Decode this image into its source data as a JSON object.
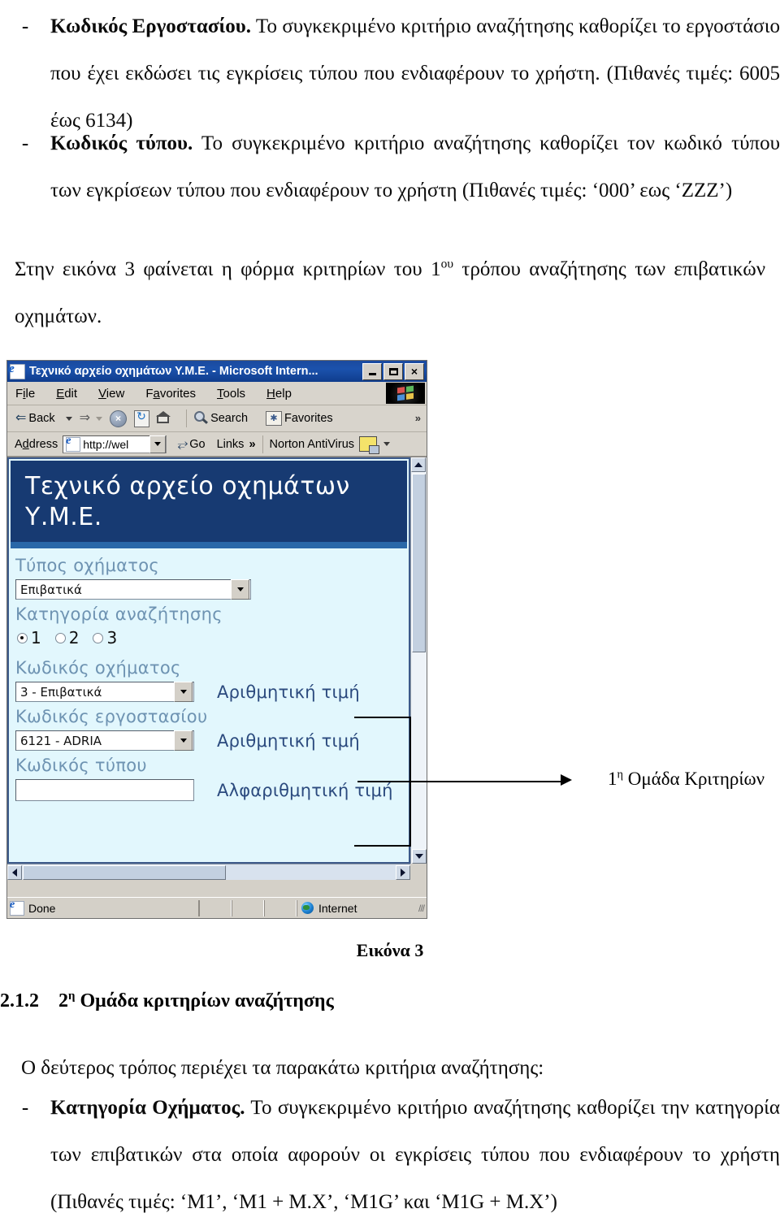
{
  "document": {
    "bullets_top": [
      {
        "dash": "-",
        "term": "Κωδικός Εργοστασίου.",
        "text": " Το συγκεκριμένο κριτήριο αναζήτησης καθορίζει το εργοστάσιο που έχει εκδώσει τις εγκρίσεις τύπου που ενδιαφέρουν το χρήστη. (Πιθανές τιμές: 6005 έως 6134)"
      },
      {
        "dash": "-",
        "term": "Κωδικός τύπου.",
        "text": " Το συγκεκριμένο κριτήριο αναζήτησης καθορίζει τον κωδικό τύπου των εγκρίσεων τύπου που ενδιαφέρουν το χρήστη (Πιθανές τιμές: ‘000’ εως ‘ZZZ’)"
      }
    ],
    "paragraph_intro_a": "Στην εικόνα 3 φαίνεται η φόρμα κριτηρίων του 1",
    "paragraph_intro_sup": "ου",
    "paragraph_intro_b": " τρόπου αναζήτησης των επιβατικών οχημάτων.",
    "figure_caption": "Εικόνα 3",
    "section": {
      "number": "2.1.2",
      "title_a": "2",
      "title_sup": "η",
      "title_b": " Ομάδα κριτηρίων αναζήτησης"
    },
    "paragraph_second": "Ο δεύτερος τρόπος  περιέχει τα παρακάτω κριτήρια αναζήτησης:",
    "bullets_bottom": [
      {
        "dash": "-",
        "term": "Κατηγορία Οχήματος.",
        "text": " Το συγκεκριμένο κριτήριο αναζήτησης καθορίζει την κατηγορία των επιβατικών στα οποία αφορούν οι εγκρίσεις τύπου που ενδιαφέρουν το χρήστη (Πιθανές τιμές: ‘M1’, ‘M1 + M.X’, ‘M1G’ και ‘M1G + M.X’)"
      }
    ]
  },
  "annotation": {
    "label_a": "1",
    "label_sup": "η",
    "label_b": " Ομάδα Κριτηρίων"
  },
  "browser": {
    "title": "Τεχνικό αρχείο οχημάτων Υ.Μ.Ε. - Microsoft Intern...",
    "window_buttons": {
      "minimize": "minimize-icon",
      "maximize": "maximize-icon",
      "close": "×"
    },
    "menu": [
      {
        "pre": "F",
        "key": "i",
        "post": "le"
      },
      {
        "pre": "",
        "key": "E",
        "post": "dit"
      },
      {
        "pre": "",
        "key": "V",
        "post": "iew"
      },
      {
        "pre": "F",
        "key": "a",
        "post": "vorites"
      },
      {
        "pre": "",
        "key": "T",
        "post": "ools"
      },
      {
        "pre": "",
        "key": "H",
        "post": "elp"
      }
    ],
    "toolbar": {
      "back": "Back",
      "search": "Search",
      "favorites": "Favorites",
      "overflow": "»"
    },
    "address": {
      "label_pre": "A",
      "label_key": "d",
      "label_post": "dress",
      "value": "http://wel",
      "placeholder": "http://",
      "go": "Go",
      "links": "Links",
      "links_overflow": "»",
      "norton": "Norton AntiVirus"
    },
    "status": {
      "text": "Done",
      "zone": "Internet"
    }
  },
  "webpage": {
    "header_title": "Τεχνικό αρχείο οχημάτων Υ.Μ.Ε.",
    "fields": [
      {
        "label": "Τύπος οχήματος",
        "type": "select",
        "value": "Επιβατικά",
        "hint": ""
      },
      {
        "label": "Κατηγορία αναζήτησης",
        "type": "radio",
        "options": [
          "1",
          "2",
          "3"
        ],
        "selected": "1"
      },
      {
        "label": "Κωδικός οχήματος",
        "type": "select",
        "value": "3 - Επιβατικά",
        "hint": "Αριθμητική τιμή"
      },
      {
        "label": "Κωδικός εργοστασίου",
        "type": "select",
        "value": "6121 - ADRIA",
        "hint": "Αριθμητική τιμή"
      },
      {
        "label": "Κωδικός τύπου",
        "type": "text",
        "value": "",
        "hint": "Αλφαριθμητική τιμή"
      }
    ]
  },
  "colors": {
    "titlebar_blue": "#1b4a9e",
    "page_header_navy": "#173a72",
    "page_bg_cyan": "#e2f7fd",
    "field_label_blue": "#6e93b2",
    "hint_blue": "#2b4a7e",
    "chrome_gray": "#d4d0c8"
  }
}
